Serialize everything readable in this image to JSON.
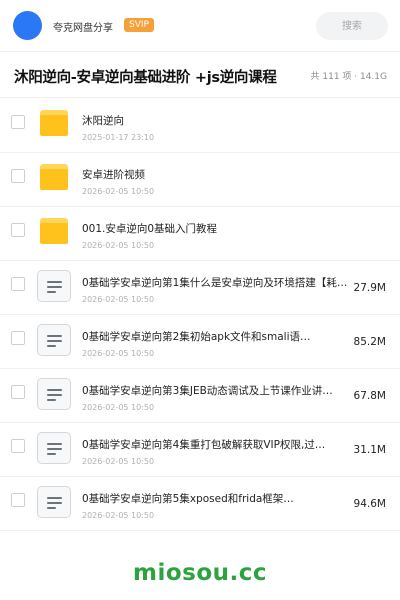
{
  "header": {
    "share_name": "夸克网盘分享",
    "vip_badge": "SVIP",
    "search_placeholder": "搜索"
  },
  "folder": {
    "title": "沐阳逆向-安卓逆向基础进阶 +js逆向课程",
    "meta": "共 111 项 · 14.1G"
  },
  "items": [
    {
      "type": "folder",
      "name": "沐阳逆向",
      "date": "2025-01-17 23:10",
      "size": ""
    },
    {
      "type": "folder",
      "name": "安卓进阶视频",
      "date": "2026-02-05 10:50",
      "size": ""
    },
    {
      "type": "folder",
      "name": "001.安卓逆向0基础入门教程",
      "date": "2026-02-05 10:50",
      "size": ""
    },
    {
      "type": "file",
      "name": "0基础学安卓逆向第1集什么是安卓逆向及环境搭建【耗…",
      "date": "2026-02-05 10:50",
      "size": "27.9M"
    },
    {
      "type": "file",
      "name": "0基础学安卓逆向第2集初始apk文件和smali语…",
      "date": "2026-02-05 10:50",
      "size": "85.2M"
    },
    {
      "type": "file",
      "name": "0基础学安卓逆向第3集JEB动态调试及上节课作业讲…",
      "date": "2026-02-05 10:50",
      "size": "67.8M"
    },
    {
      "type": "file",
      "name": "0基础学安卓逆向第4集重打包破解获取VIP权限,过…",
      "date": "2026-02-05 10:50",
      "size": "31.1M"
    },
    {
      "type": "file",
      "name": "0基础学安卓逆向第5集xposed和frida框架…",
      "date": "2026-02-05 10:50",
      "size": "94.6M"
    }
  ],
  "watermark": "miosou.cc",
  "colors": {
    "accent": "#2b78f6",
    "vip": "#f6a03a",
    "folder": "#ffc21c",
    "watermark": "#2ca33f"
  }
}
